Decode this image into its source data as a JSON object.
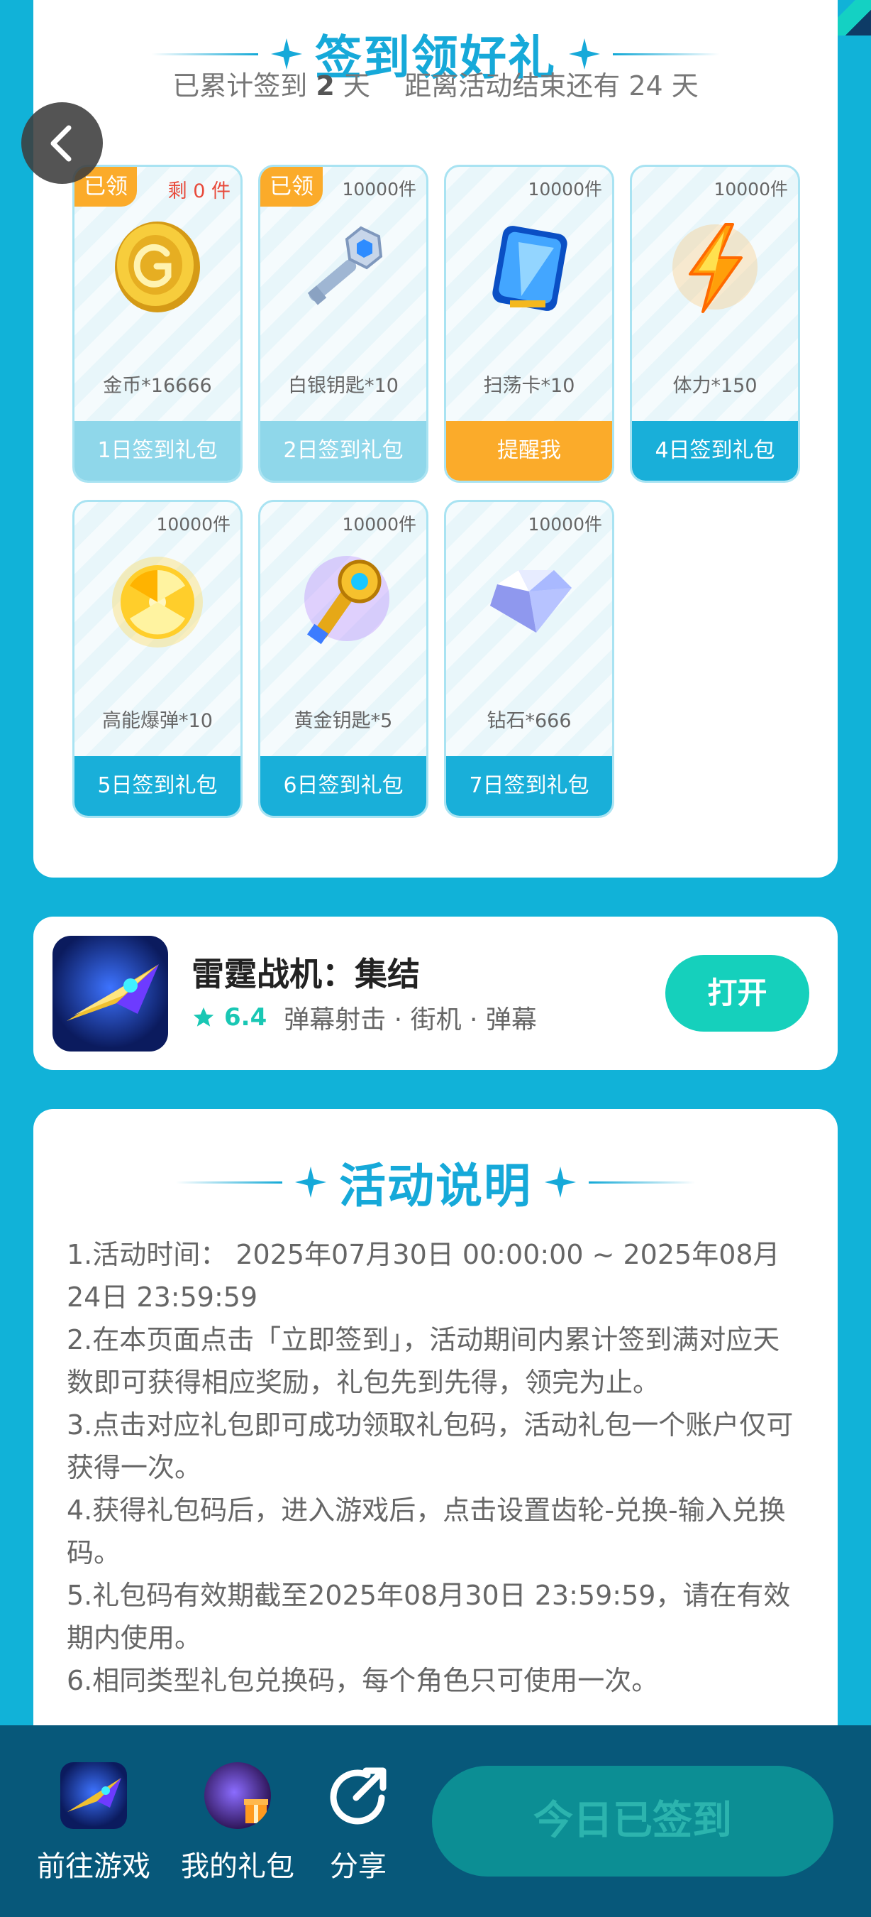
{
  "signin": {
    "title": "签到领好礼",
    "stats_prefix": "已累计签到",
    "days_signed": "2",
    "days_unit": "天",
    "remaining_prefix": "距离活动结束还有",
    "days_left": "24",
    "remaining_unit": "天",
    "gifts": [
      {
        "name": "金币*16666",
        "stock": "剩 0 件",
        "claimed_tag": "已领",
        "button": "1日签到礼包",
        "icon": "gold-coin-icon",
        "state": "claimed"
      },
      {
        "name": "白银钥匙*10",
        "stock": "10000件",
        "claimed_tag": "已领",
        "button": "2日签到礼包",
        "icon": "silver-key-icon",
        "state": "claimed"
      },
      {
        "name": "扫荡卡*10",
        "stock": "10000件",
        "button": "提醒我",
        "icon": "sweep-card-icon",
        "state": "remind"
      },
      {
        "name": "体力*150",
        "stock": "10000件",
        "button": "4日签到礼包",
        "icon": "lightning-icon",
        "state": "pending"
      },
      {
        "name": "高能爆弹*10",
        "stock": "10000件",
        "button": "5日签到礼包",
        "icon": "energy-bomb-icon",
        "state": "pending"
      },
      {
        "name": "黄金钥匙*5",
        "stock": "10000件",
        "button": "6日签到礼包",
        "icon": "gold-key-icon",
        "state": "pending"
      },
      {
        "name": "钻石*666",
        "stock": "10000件",
        "button": "7日签到礼包",
        "icon": "diamond-icon",
        "state": "pending"
      }
    ]
  },
  "game": {
    "name": "雷霆战机：集结",
    "rating": "6.4",
    "tags": "弹幕射击 · 街机 · 弹幕",
    "open_label": "打开"
  },
  "rules": {
    "title": "活动说明",
    "lines": [
      "1.活动时间：  2025年07月30日  00:00:00 ~ 2025年08月24日 23:59:59",
      "2.在本页面点击「立即签到」，活动期间内累计签到满对应天数即可获得相应奖励，礼包先到先得，领完为止。",
      "3.点击对应礼包即可成功领取礼包码，活动礼包一个账户仅可获得一次。",
      "4.获得礼包码后，进入游戏后，点击设置齿轮-兑换-输入兑换码。",
      "5.礼包码有效期截至2025年08月30日  23:59:59，请在有效期内使用。",
      "6.相同类型礼包兑换码，每个角色只可使用一次。"
    ]
  },
  "bottom_bar": {
    "go_game": "前往游戏",
    "my_gifts": "我的礼包",
    "share": "分享",
    "checkin": "今日已签到"
  },
  "colors": {
    "background": "#11b2d8",
    "accent": "#16a9d9",
    "claimed_orange": "#fbab2a",
    "open_green": "#15d0bc"
  }
}
